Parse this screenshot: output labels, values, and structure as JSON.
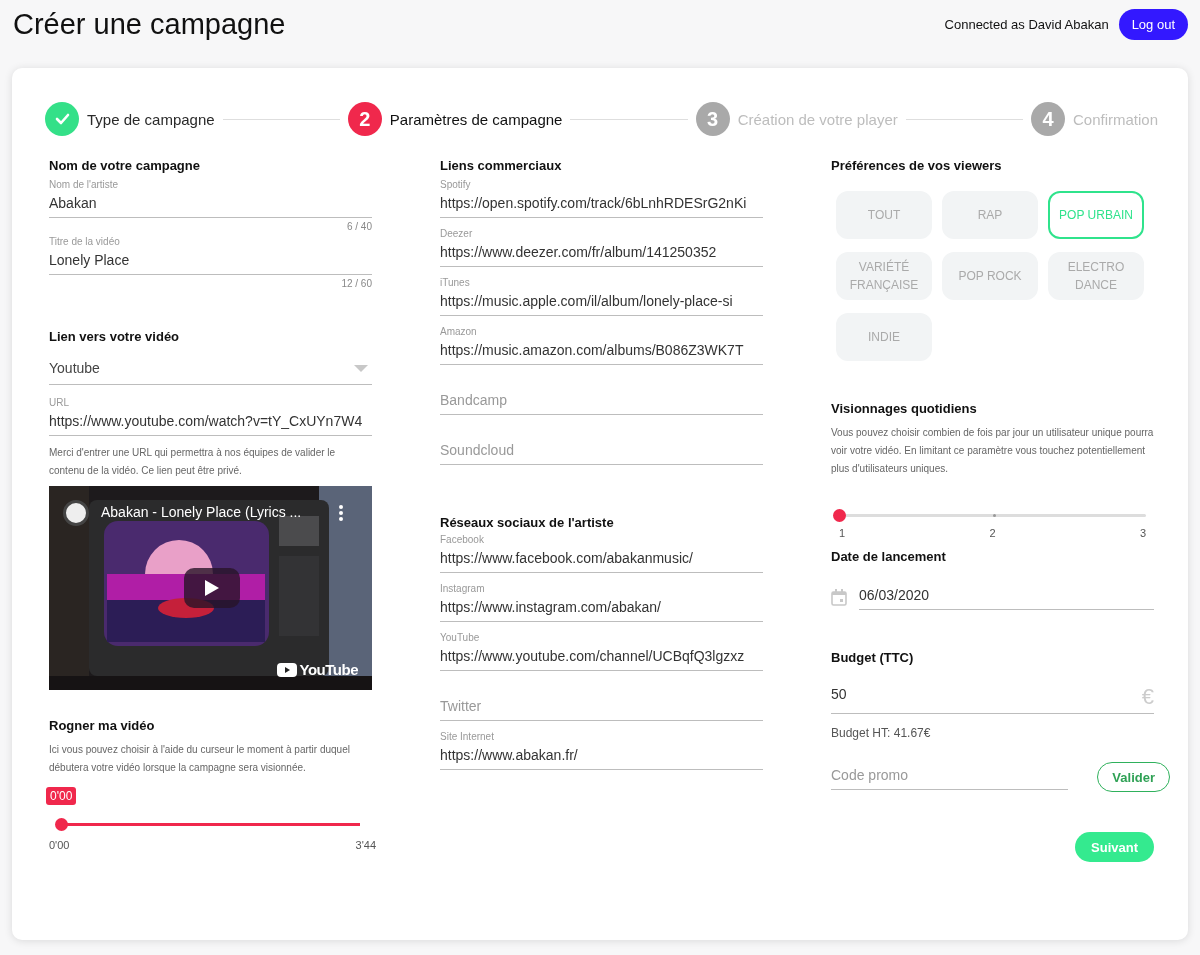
{
  "header": {
    "title": "Créer une campagne",
    "user_label": "Connected as David Abakan",
    "logout": "Log out"
  },
  "steps": [
    {
      "label": "Type de campagne",
      "completed": true,
      "selected": false
    },
    {
      "number": "2",
      "label": "Paramètres de campagne",
      "completed": false,
      "selected": true
    },
    {
      "number": "3",
      "label": "Création de votre player",
      "completed": false,
      "selected": false
    },
    {
      "number": "4",
      "label": "Confirmation",
      "completed": false,
      "selected": false
    }
  ],
  "campaign_name": {
    "heading": "Nom de votre campagne",
    "fields": [
      {
        "label": "Nom de l'artiste",
        "value": "Abakan",
        "counter": "6 / 40"
      },
      {
        "label": "Titre de la vidéo",
        "value": "Lonely Place",
        "counter": "12 / 60"
      }
    ]
  },
  "video_link": {
    "heading": "Lien vers votre vidéo",
    "platform": "Youtube",
    "url_label": "URL",
    "url": "https://www.youtube.com/watch?v=tY_CxUYn7W4",
    "help": "Merci d'entrer une URL qui permettra à nos équipes de valider le contenu de la vidéo. Ce lien peut être privé.",
    "player": {
      "title": "Abakan - Lonely Place (Lyrics ...",
      "logo": "YouTube"
    }
  },
  "trim": {
    "heading": "Rogner ma vidéo",
    "help": "Ici vous pouvez choisir à l'aide du curseur le moment à partir duquel débutera votre vidéo lorsque la campagne sera visionnée.",
    "tooltip": "0'00",
    "level": 0,
    "start": "0'00",
    "end": "3'44"
  },
  "commercial_links": {
    "heading": "Liens commerciaux",
    "fields": [
      {
        "label": "Spotify",
        "value": "https://open.spotify.com/track/6bLnhRDESrG2nKi"
      },
      {
        "label": "Deezer",
        "value": "https://www.deezer.com/fr/album/141250352"
      },
      {
        "label": "iTunes",
        "value": "https://music.apple.com/il/album/lonely-place-si"
      },
      {
        "label": "Amazon",
        "value": "https://music.amazon.com/albums/B086Z3WK7T"
      },
      {
        "placeholder": "Bandcamp"
      },
      {
        "placeholder": "Soundcloud"
      }
    ]
  },
  "social_links": {
    "heading": "Réseaux sociaux de l'artiste",
    "fields": [
      {
        "label": "Facebook",
        "value": "https://www.facebook.com/abakanmusic/"
      },
      {
        "label": "Instagram",
        "value": "https://www.instagram.com/abakan/"
      },
      {
        "label": "YouTube",
        "value": "https://www.youtube.com/channel/UCBqfQ3lgzxz"
      },
      {
        "placeholder": "Twitter"
      },
      {
        "label": "Site Internet",
        "value": "https://www.abakan.fr/"
      }
    ]
  },
  "viewers": {
    "heading": "Préférences de vos viewers",
    "genres": [
      {
        "label": "TOUT",
        "selected": false
      },
      {
        "label": "RAP",
        "selected": false
      },
      {
        "label": "POP URBAIN",
        "selected": true
      },
      {
        "label": "VARIÉTÉ FRANÇAISE",
        "selected": false
      },
      {
        "label": "POP ROCK",
        "selected": false
      },
      {
        "label": "ELECTRO DANCE",
        "selected": false
      },
      {
        "label": "INDIE",
        "selected": false
      }
    ]
  },
  "daily_views": {
    "heading": "Visionnages quotidiens",
    "help": "Vous pouvez choisir combien de fois par jour un utilisateur unique pourra voir votre vidéo. En limitant ce paramètre vous touchez potentiellement plus d'utilisateurs uniques.",
    "level": 0,
    "ticks": [
      "1",
      "2",
      "3"
    ]
  },
  "launch_date": {
    "heading": "Date de lancement",
    "value": "06/03/2020"
  },
  "budget": {
    "heading": "Budget (TTC)",
    "value": "50",
    "currency": "€",
    "ht": "Budget HT: 41.67€",
    "promo_placeholder": "Code promo",
    "validate": "Valider"
  },
  "next": "Suivant"
}
